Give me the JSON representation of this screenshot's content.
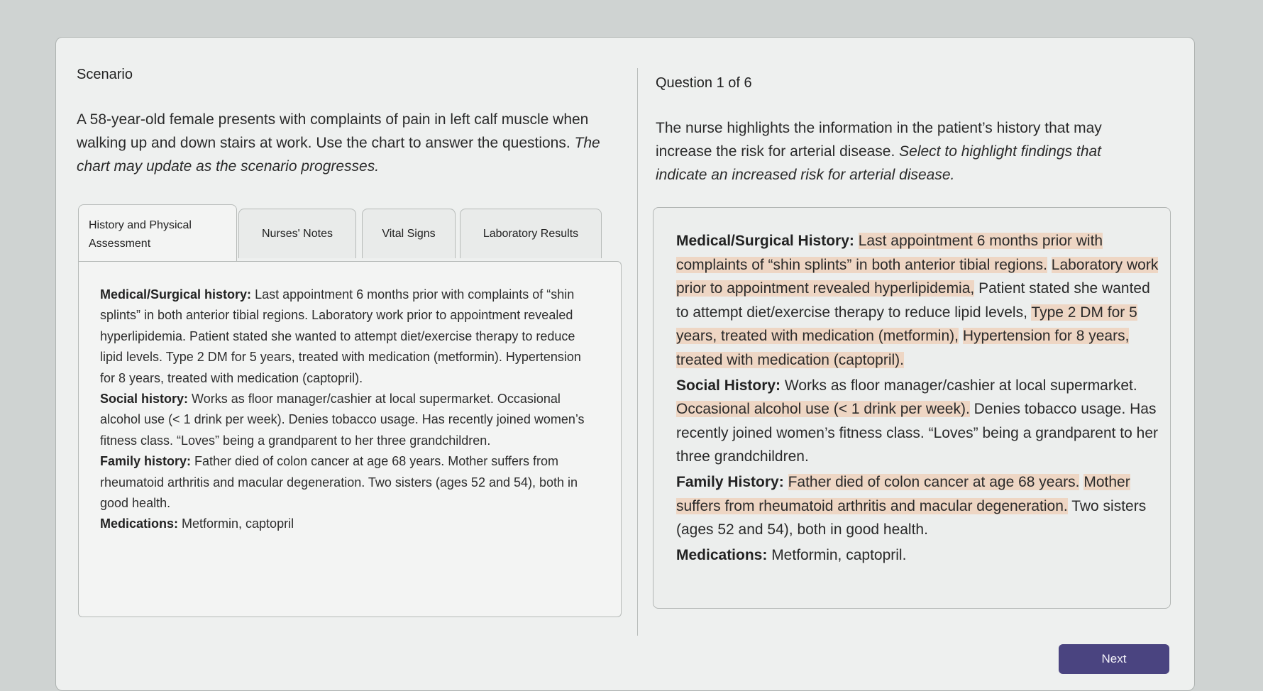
{
  "scenario": {
    "label": "Scenario",
    "text_plain": "A 58-year-old female presents with complaints of pain in left calf muscle when walking up and down stairs at work. Use the chart to answer the questions. ",
    "text_italic": "The chart may update as the scenario progresses."
  },
  "tabs": [
    {
      "label": "History and Physical Assessment",
      "active": true
    },
    {
      "label": "Nurses' Notes",
      "active": false
    },
    {
      "label": "Vital Signs",
      "active": false
    },
    {
      "label": "Laboratory Results",
      "active": false
    }
  ],
  "chart": {
    "med_heading": "Medical/Surgical history:",
    "med_text": " Last appointment 6 months prior with complaints of “shin splints” in both anterior tibial regions. Laboratory work prior to appointment revealed hyperlipidemia. Patient stated she wanted to attempt diet/exercise therapy to reduce lipid levels. Type 2 DM for 5 years, treated with medication (metformin). Hypertension for 8 years, treated with medication (captopril).",
    "social_heading": "Social history:",
    "social_text": " Works as floor manager/cashier at local supermarket. Occasional alcohol use (< 1 drink per week). Denies tobacco usage. Has recently joined women’s fitness class. “Loves” being a grandparent to her three grandchildren.",
    "family_heading": "Family history:",
    "family_text": " Father died of colon cancer at age 68 years. Mother suffers from rheumatoid arthritis and macular degeneration. Two sisters (ages 52 and 54), both in good health.",
    "meds_heading": "Medications:",
    "meds_text": " Metformin, captopril"
  },
  "question": {
    "label": "Question 1 of 6",
    "text_plain": "The nurse highlights the information in the patient’s history that may increase the risk for arterial disease. ",
    "text_italic": "Select to highlight findings that indicate an increased risk for arterial disease."
  },
  "answer": {
    "med_heading": "Medical/Surgical History:",
    "med_segments": [
      {
        "text": "Last appointment 6 months prior with complaints of “shin splints” in both anterior tibial regions.",
        "highlighted": true
      },
      {
        "text": "Laboratory work prior to appointment revealed hyperlipidemia,",
        "highlighted": true
      },
      {
        "text": "Patient stated she wanted to attempt diet/exercise therapy to reduce lipid levels,",
        "highlighted": false
      },
      {
        "text": "Type 2 DM for 5 years, treated with medication (metformin),",
        "highlighted": true
      },
      {
        "text": "Hypertension for 8 years, treated with medication (captopril).",
        "highlighted": true
      }
    ],
    "social_heading": "Social History:",
    "social_segments": [
      {
        "text": "Works as floor manager/cashier at local supermarket.",
        "highlighted": false
      },
      {
        "text": "Occasional alcohol use (< 1 drink per week).",
        "highlighted": true
      },
      {
        "text": "Denies tobacco usage.",
        "highlighted": false
      },
      {
        "text": "Has recently joined women’s fitness class.",
        "highlighted": false
      },
      {
        "text": "“Loves” being a grandparent to her three grandchildren.",
        "highlighted": false
      }
    ],
    "family_heading": "Family History:",
    "family_segments": [
      {
        "text": "Father died of colon cancer at age 68 years.",
        "highlighted": true
      },
      {
        "text": "Mother suffers from rheumatoid arthritis and macular degeneration.",
        "highlighted": true
      },
      {
        "text": "Two sisters (ages 52 and 54), both in good health.",
        "highlighted": false
      }
    ],
    "meds_heading": "Medications:",
    "meds_text": " Metformin, captopril."
  },
  "next_button": {
    "label": "Next"
  },
  "colors": {
    "highlight": "#eed6c4",
    "next_button": "#4a4480"
  }
}
